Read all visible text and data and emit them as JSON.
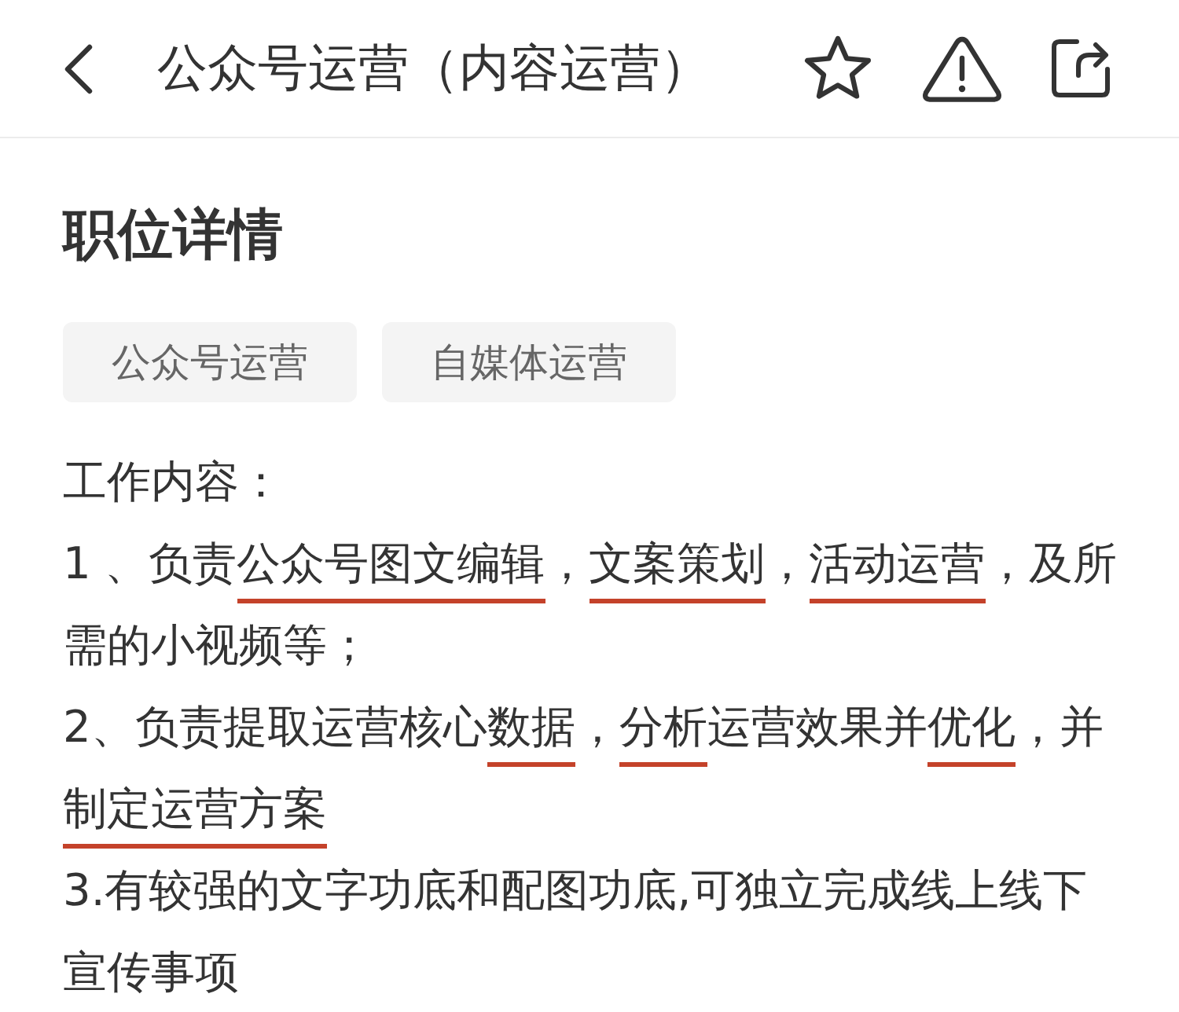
{
  "header": {
    "title": "公众号运营（内容运营）"
  },
  "section": {
    "title": "职位详情",
    "tags": [
      "公众号运营",
      "自媒体运营"
    ]
  },
  "description": {
    "heading": "工作内容：",
    "items": [
      {
        "parts": [
          {
            "text": "1 、负责",
            "underlined": false
          },
          {
            "text": "公众号图文编辑",
            "underlined": true
          },
          {
            "text": "，",
            "underlined": false
          },
          {
            "text": "文案策划",
            "underlined": true
          },
          {
            "text": "，",
            "underlined": false
          },
          {
            "text": "活动运营",
            "underlined": true
          },
          {
            "text": "，及所需的小视频等；",
            "underlined": false
          }
        ]
      },
      {
        "parts": [
          {
            "text": "2、负责提取运营核心",
            "underlined": false
          },
          {
            "text": "数据",
            "underlined": true
          },
          {
            "text": "，",
            "underlined": false
          },
          {
            "text": "分析",
            "underlined": true
          },
          {
            "text": "运营效果并",
            "underlined": false
          },
          {
            "text": "优化",
            "underlined": true
          },
          {
            "text": "，并",
            "underlined": false
          },
          {
            "text": "制定运营方案",
            "underlined": true
          }
        ]
      },
      {
        "parts": [
          {
            "text": "3.有较强的文字功底和配图功底,可独立完成线上线下宣传事项",
            "underlined": false
          }
        ]
      }
    ]
  }
}
